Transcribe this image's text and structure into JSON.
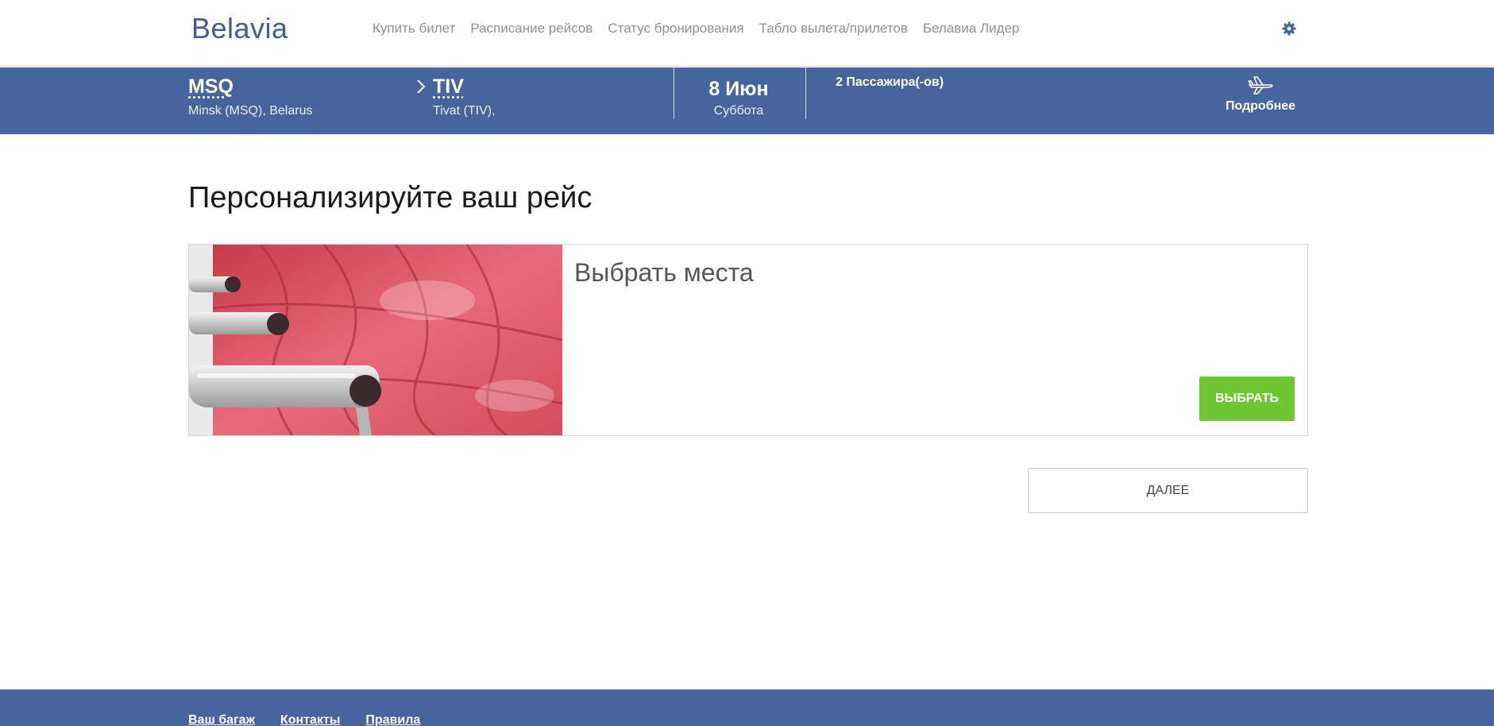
{
  "header": {
    "logo": "Belavia",
    "nav": [
      {
        "label": "Купить билет"
      },
      {
        "label": "Расписание рейсов"
      },
      {
        "label": "Статус бронирования"
      },
      {
        "label": "Табло вылета/прилетов"
      },
      {
        "label": "Белавиа Лидер"
      }
    ],
    "settings_icon": "gear-icon"
  },
  "booking": {
    "origin": {
      "code": "MSQ",
      "name": "Minsk (MSQ), Belarus"
    },
    "destination": {
      "code": "TIV",
      "name": "Tivat (TIV),"
    },
    "date": "8 Июн",
    "weekday": "Суббота",
    "passengers": "2 Пассажира(-ов)",
    "details_label": "Подробнее",
    "details_icon": "plane-icon",
    "separator_icon": "chevron-right-icon"
  },
  "main": {
    "title": "Персонализируйте ваш рейс",
    "card": {
      "title": "Выбрать места",
      "button_label": "ВЫБРАТЬ",
      "image": "red-seats-photo"
    },
    "next_label": "ДАЛЕЕ"
  },
  "footer": {
    "links": [
      {
        "label": "Ваш багаж"
      },
      {
        "label": "Контакты"
      },
      {
        "label": "Правила"
      }
    ]
  },
  "colors": {
    "brand": "#46659e",
    "accent": "#6ec630"
  }
}
